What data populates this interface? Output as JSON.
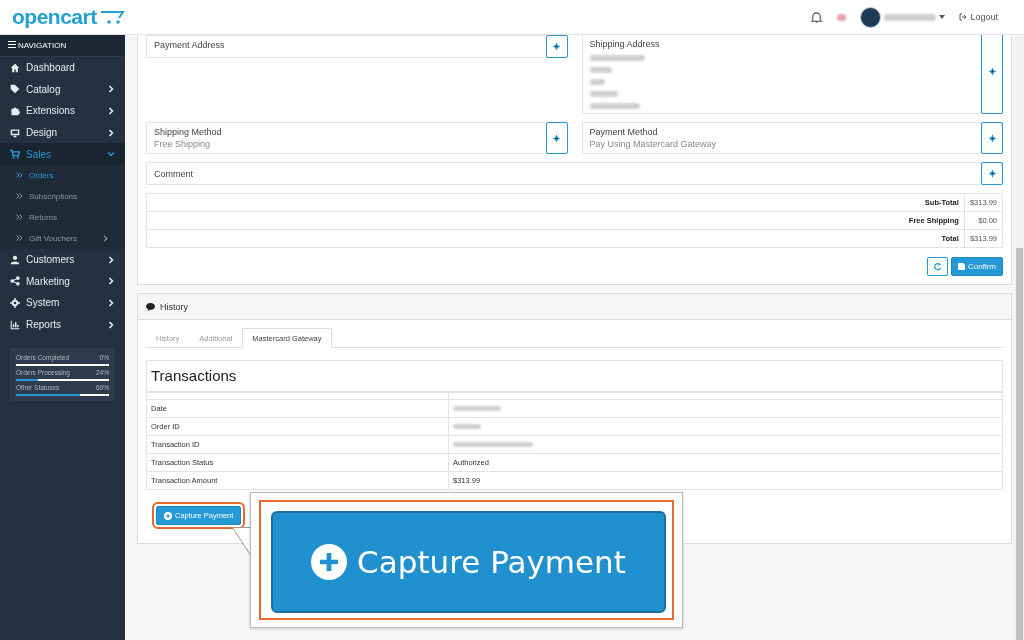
{
  "header": {
    "logo": "opencart",
    "logout": "Logout"
  },
  "sidebar": {
    "title": "NAVIGATION",
    "items": [
      {
        "label": "Dashboard",
        "has_children": false,
        "selected": false
      },
      {
        "label": "Catalog",
        "expanded": false,
        "has_children": true,
        "selected": false
      },
      {
        "label": "Extensions",
        "expanded": false,
        "has_children": true,
        "selected": false
      },
      {
        "label": "Design",
        "expanded": false,
        "has_children": true,
        "selected": false
      },
      {
        "label": "Sales",
        "expanded": true,
        "has_children": true,
        "selected": true,
        "children": [
          {
            "label": "Orders",
            "selected": true,
            "has_children": false
          },
          {
            "label": "Subscriptions",
            "selected": false,
            "has_children": false
          },
          {
            "label": "Returns",
            "selected": false,
            "has_children": false
          },
          {
            "label": "Gift Vouchers",
            "selected": false,
            "has_children": true
          }
        ]
      },
      {
        "label": "Customers",
        "expanded": false,
        "has_children": true,
        "selected": false
      },
      {
        "label": "Marketing",
        "expanded": false,
        "has_children": true,
        "selected": false
      },
      {
        "label": "System",
        "expanded": false,
        "has_children": true,
        "selected": false
      },
      {
        "label": "Reports",
        "expanded": false,
        "has_children": true,
        "selected": false
      }
    ],
    "stats": [
      {
        "label": "Orders Completed",
        "reading": "0%",
        "level": 0
      },
      {
        "label": "Orders Processing",
        "reading": "24%",
        "level": 0.24
      },
      {
        "label": "Other Statuses",
        "reading": "69%",
        "level": 0.69
      }
    ]
  },
  "order": {
    "payment_address": {
      "title": "Payment Address"
    },
    "shipping_address": {
      "title": "Shipping Address"
    },
    "shipping_method": {
      "title": "Shipping Method",
      "value": "Free Shipping"
    },
    "payment_method": {
      "title": "Payment Method",
      "value": "Pay Using Mastercard Gateway"
    },
    "comment": {
      "title": "Comment"
    },
    "totals": [
      {
        "label": "Sub-Total",
        "value": "$313.99"
      },
      {
        "label": "Free Shipping",
        "value": "$0.00"
      },
      {
        "label": "Total",
        "value": "$313.99"
      }
    ],
    "confirm_button": "Confirm"
  },
  "history": {
    "title": "History",
    "tabs": [
      {
        "label": "History",
        "selected": false
      },
      {
        "label": "Additional",
        "selected": false
      },
      {
        "label": "Mastercard Gateway",
        "selected": true
      }
    ],
    "transactions": {
      "title": "Transactions",
      "rows": [
        {
          "label": "Date"
        },
        {
          "label": "Order ID"
        },
        {
          "label": "Transaction ID"
        },
        {
          "label": "Transaction Status",
          "value": "Authorized"
        },
        {
          "label": "Transaction Amount",
          "value": "$313.99"
        }
      ]
    },
    "capture_button": "Capture Payment"
  },
  "callout": {
    "button": "Capture Payment"
  }
}
